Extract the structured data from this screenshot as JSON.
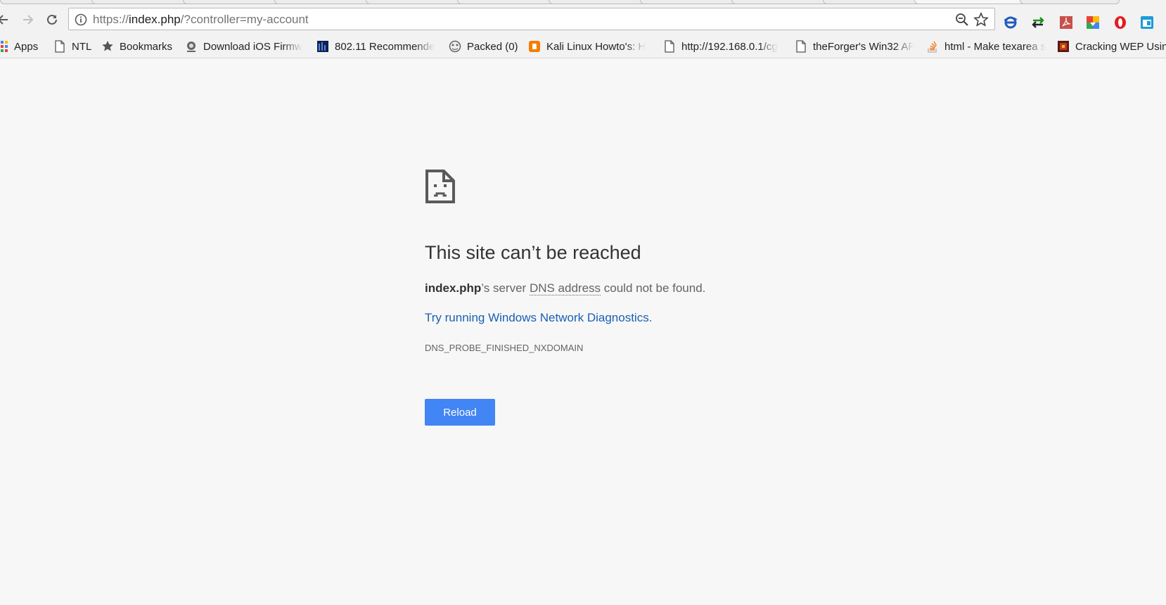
{
  "browser": {
    "address_bar": {
      "url_prefix": "https://",
      "url_host": "index.php",
      "url_rest": "/?controller=my-account"
    }
  },
  "bookmarks": [
    {
      "label": "Apps",
      "icon": "apps-grid-icon"
    },
    {
      "label": "NTL",
      "icon": "page-icon"
    },
    {
      "label": "Bookmarks",
      "icon": "star-icon"
    },
    {
      "label": "Download iOS Firmw",
      "icon": "download-site-icon"
    },
    {
      "label": "802.11 Recommende",
      "icon": "site-icon"
    },
    {
      "label": "Packed (0)",
      "icon": "packed-icon"
    },
    {
      "label": "Kali Linux Howto's: H",
      "icon": "blogger-icon"
    },
    {
      "label": "http://192.168.0.1/cg",
      "icon": "page-icon"
    },
    {
      "label": "theForger's Win32 AP",
      "icon": "page-icon"
    },
    {
      "label": "html - Make texarea s",
      "icon": "stackoverflow-icon"
    },
    {
      "label": "Cracking WEP Usin",
      "icon": "site-icon"
    }
  ],
  "error_page": {
    "icon": "sad-page-icon",
    "title": "This site can’t be reached",
    "desc_host": "index.php",
    "desc_part1": "’s server ",
    "desc_abbr": "DNS address",
    "desc_part2": " could not be found.",
    "diagnostics_link": "Try running Windows Network Diagnostics.",
    "error_code": "DNS_PROBE_FINISHED_NXDOMAIN",
    "reload_label": "Reload"
  },
  "colors": {
    "accent": "#4285f4",
    "link": "#1a5fb4",
    "background": "#f7f7f7"
  }
}
